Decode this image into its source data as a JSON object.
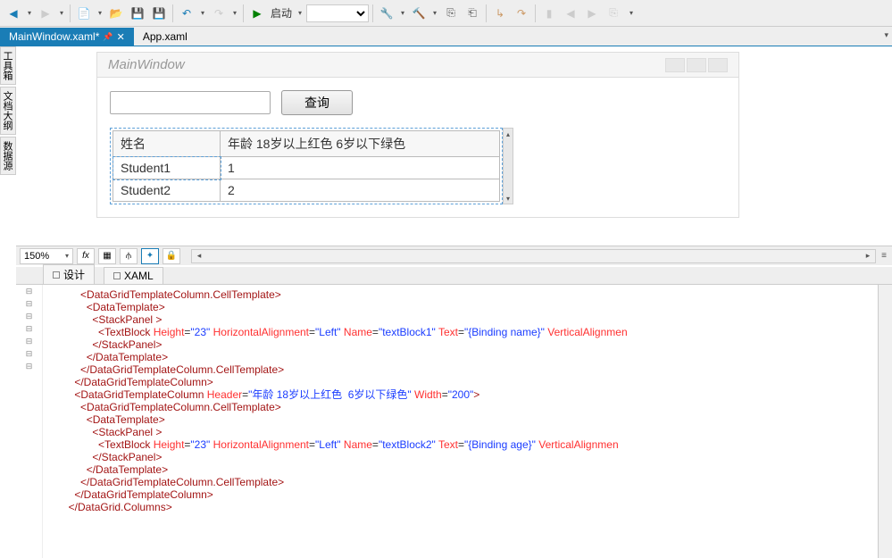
{
  "toolbar": {
    "start_label": "启动"
  },
  "tabs": [
    {
      "label": "MainWindow.xaml*",
      "active": true
    },
    {
      "label": "App.xaml",
      "active": false
    }
  ],
  "sideboxes": [
    "工具箱",
    "文档大纲",
    "数据源"
  ],
  "designer": {
    "window_title": "MainWindow",
    "query_button": "查询",
    "columns": [
      "姓名",
      "年龄 18岁以上红色  6岁以下绿色"
    ],
    "rows": [
      {
        "name": "Student1",
        "age": "1"
      },
      {
        "name": "Student2",
        "age": "2"
      }
    ],
    "zoom": "150%"
  },
  "panel_tabs": {
    "design": "设计",
    "xaml": "XAML"
  },
  "code_lines": [
    {
      "indent": 12,
      "parts": [
        {
          "t": "tag",
          "v": "<DataGridTemplateColumn.CellTemplate>"
        }
      ]
    },
    {
      "indent": 14,
      "parts": [
        {
          "t": "tag",
          "v": "<DataTemplate>"
        }
      ]
    },
    {
      "indent": 16,
      "parts": [
        {
          "t": "tag",
          "v": "<StackPanel "
        },
        {
          "t": "tag",
          "v": ">"
        }
      ]
    },
    {
      "indent": 18,
      "parts": [
        {
          "t": "tag",
          "v": "<TextBlock "
        },
        {
          "t": "attr",
          "v": "Height"
        },
        {
          "t": "plain",
          "v": "="
        },
        {
          "t": "val",
          "v": "\"23\" "
        },
        {
          "t": "attr",
          "v": "HorizontalAlignment"
        },
        {
          "t": "plain",
          "v": "="
        },
        {
          "t": "val",
          "v": "\"Left\" "
        },
        {
          "t": "attr",
          "v": "Name"
        },
        {
          "t": "plain",
          "v": "="
        },
        {
          "t": "val",
          "v": "\"textBlock1\" "
        },
        {
          "t": "attr",
          "v": "Text"
        },
        {
          "t": "plain",
          "v": "="
        },
        {
          "t": "val",
          "v": "\"{Binding name}\" "
        },
        {
          "t": "attr",
          "v": "VerticalAlignmen"
        }
      ]
    },
    {
      "indent": 16,
      "parts": [
        {
          "t": "tag",
          "v": "</StackPanel>"
        }
      ]
    },
    {
      "indent": 14,
      "parts": [
        {
          "t": "tag",
          "v": "</DataTemplate>"
        }
      ]
    },
    {
      "indent": 12,
      "parts": [
        {
          "t": "tag",
          "v": "</DataGridTemplateColumn.CellTemplate>"
        }
      ]
    },
    {
      "indent": 10,
      "parts": [
        {
          "t": "tag",
          "v": "</DataGridTemplateColumn>"
        }
      ]
    },
    {
      "indent": 0,
      "parts": [
        {
          "t": "plain",
          "v": ""
        }
      ]
    },
    {
      "indent": 10,
      "parts": [
        {
          "t": "tag",
          "v": "<DataGridTemplateColumn "
        },
        {
          "t": "attr",
          "v": "Header"
        },
        {
          "t": "plain",
          "v": "="
        },
        {
          "t": "val",
          "v": "\"年龄 18岁以上红色  6岁以下绿色\" "
        },
        {
          "t": "attr",
          "v": "Width"
        },
        {
          "t": "plain",
          "v": "="
        },
        {
          "t": "val",
          "v": "\"200\""
        },
        {
          "t": "tag",
          "v": ">"
        }
      ]
    },
    {
      "indent": 12,
      "parts": [
        {
          "t": "tag",
          "v": "<DataGridTemplateColumn.CellTemplate>"
        }
      ]
    },
    {
      "indent": 14,
      "parts": [
        {
          "t": "tag",
          "v": "<DataTemplate>"
        }
      ]
    },
    {
      "indent": 16,
      "parts": [
        {
          "t": "tag",
          "v": "<StackPanel "
        },
        {
          "t": "tag",
          "v": ">"
        }
      ]
    },
    {
      "indent": 18,
      "parts": [
        {
          "t": "tag",
          "v": "<TextBlock "
        },
        {
          "t": "attr",
          "v": "Height"
        },
        {
          "t": "plain",
          "v": "="
        },
        {
          "t": "val",
          "v": "\"23\" "
        },
        {
          "t": "attr",
          "v": "HorizontalAlignment"
        },
        {
          "t": "plain",
          "v": "="
        },
        {
          "t": "val",
          "v": "\"Left\" "
        },
        {
          "t": "attr",
          "v": "Name"
        },
        {
          "t": "plain",
          "v": "="
        },
        {
          "t": "val",
          "v": "\"textBlock2\" "
        },
        {
          "t": "attr",
          "v": "Text"
        },
        {
          "t": "plain",
          "v": "="
        },
        {
          "t": "val",
          "v": "\"{Binding age}\" "
        },
        {
          "t": "attr",
          "v": "VerticalAlignmen"
        }
      ]
    },
    {
      "indent": 16,
      "parts": [
        {
          "t": "tag",
          "v": "</StackPanel>"
        }
      ]
    },
    {
      "indent": 14,
      "parts": [
        {
          "t": "tag",
          "v": "</DataTemplate>"
        }
      ]
    },
    {
      "indent": 12,
      "parts": [
        {
          "t": "tag",
          "v": "</DataGridTemplateColumn.CellTemplate>"
        }
      ]
    },
    {
      "indent": 10,
      "parts": [
        {
          "t": "tag",
          "v": "</DataGridTemplateColumn>"
        }
      ]
    },
    {
      "indent": 8,
      "parts": [
        {
          "t": "tag",
          "v": "</DataGrid.Columns>"
        }
      ]
    }
  ],
  "fold_marks": [
    "⊟",
    "⊟",
    "⊟",
    "",
    "",
    "",
    "",
    "",
    "",
    "⊟",
    "⊟",
    "⊟",
    "⊟",
    "",
    "",
    "",
    "",
    "",
    ""
  ]
}
